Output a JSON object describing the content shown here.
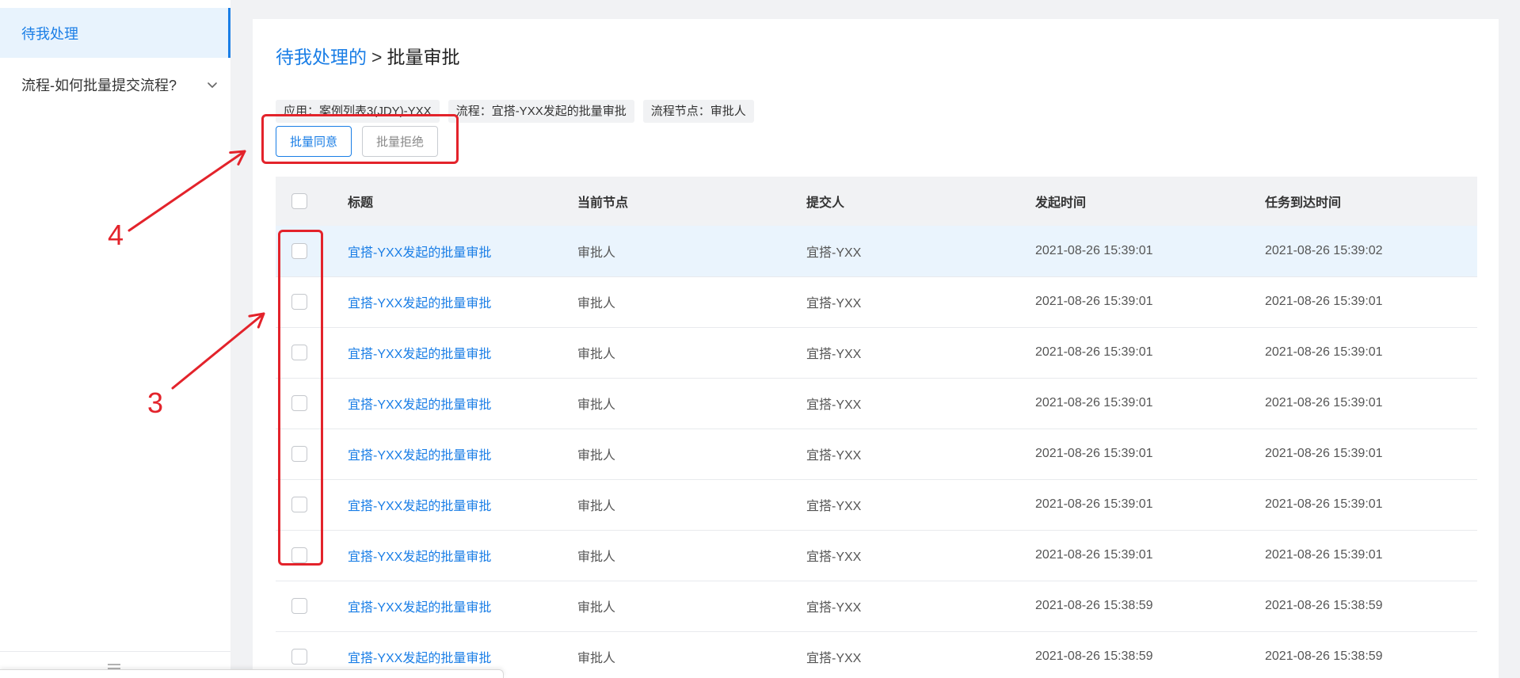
{
  "sidebar": {
    "items": [
      {
        "label": "待我处理",
        "active": true
      },
      {
        "label": "流程-如何批量提交流程?",
        "active": false
      }
    ]
  },
  "breadcrumb": {
    "parent": "待我处理的",
    "separator": ">",
    "current": "批量审批"
  },
  "tags": [
    "应用：案例列表3(JDY)-YXX",
    "流程：宜搭-YXX发起的批量审批",
    "流程节点：审批人"
  ],
  "actions": {
    "approve": "批量同意",
    "reject": "批量拒绝"
  },
  "table": {
    "columns": [
      "标题",
      "当前节点",
      "提交人",
      "发起时间",
      "任务到达时间"
    ],
    "rows": [
      {
        "title": "宜搭-YXX发起的批量审批",
        "node": "审批人",
        "submitter": "宜搭-YXX",
        "started": "2021-08-26 15:39:01",
        "arrived": "2021-08-26 15:39:02"
      },
      {
        "title": "宜搭-YXX发起的批量审批",
        "node": "审批人",
        "submitter": "宜搭-YXX",
        "started": "2021-08-26 15:39:01",
        "arrived": "2021-08-26 15:39:01"
      },
      {
        "title": "宜搭-YXX发起的批量审批",
        "node": "审批人",
        "submitter": "宜搭-YXX",
        "started": "2021-08-26 15:39:01",
        "arrived": "2021-08-26 15:39:01"
      },
      {
        "title": "宜搭-YXX发起的批量审批",
        "node": "审批人",
        "submitter": "宜搭-YXX",
        "started": "2021-08-26 15:39:01",
        "arrived": "2021-08-26 15:39:01"
      },
      {
        "title": "宜搭-YXX发起的批量审批",
        "node": "审批人",
        "submitter": "宜搭-YXX",
        "started": "2021-08-26 15:39:01",
        "arrived": "2021-08-26 15:39:01"
      },
      {
        "title": "宜搭-YXX发起的批量审批",
        "node": "审批人",
        "submitter": "宜搭-YXX",
        "started": "2021-08-26 15:39:01",
        "arrived": "2021-08-26 15:39:01"
      },
      {
        "title": "宜搭-YXX发起的批量审批",
        "node": "审批人",
        "submitter": "宜搭-YXX",
        "started": "2021-08-26 15:39:01",
        "arrived": "2021-08-26 15:39:01"
      },
      {
        "title": "宜搭-YXX发起的批量审批",
        "node": "审批人",
        "submitter": "宜搭-YXX",
        "started": "2021-08-26 15:38:59",
        "arrived": "2021-08-26 15:38:59"
      },
      {
        "title": "宜搭-YXX发起的批量审批",
        "node": "审批人",
        "submitter": "宜搭-YXX",
        "started": "2021-08-26 15:38:59",
        "arrived": "2021-08-26 15:38:59"
      }
    ]
  },
  "annotations": {
    "label_4": "4",
    "label_3": "3"
  },
  "icons": {
    "expand": "chevron-down-icon",
    "collapse": "menu-collapse-icon",
    "annotation_arrow": "arrow-icon"
  },
  "colors": {
    "accent": "#1a7ee6",
    "annotation": "#e3232b",
    "page_bg": "#f1f2f4",
    "header_bg": "#f1f2f4",
    "hover_bg": "#eaf4fd",
    "active_bg": "#e8f3fd"
  }
}
